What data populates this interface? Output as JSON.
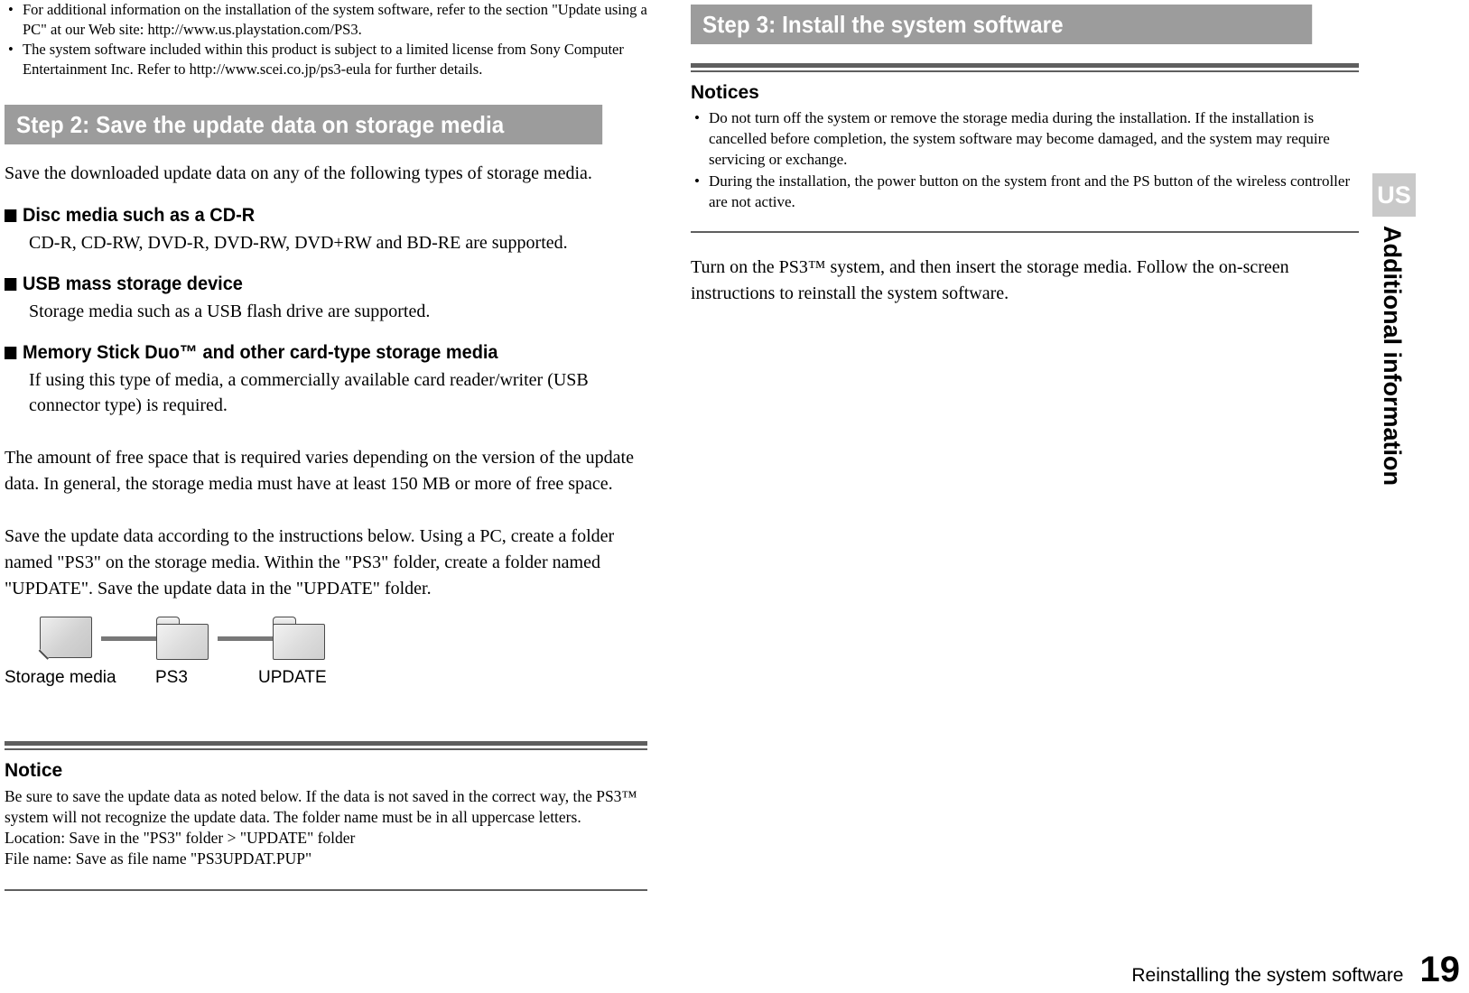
{
  "page": {
    "number": "19",
    "footer_section": "Reinstalling the system software",
    "region_tab": "US",
    "side_chapter": "Additional information"
  },
  "left_column": {
    "intro_bullets": [
      "For additional information on the installation of the system software, refer to the section \"Update using a PC\" at our Web site: http://www.us.playstation.com/PS3.",
      "The system software included within this product is subject to a limited license from Sony Computer Entertainment Inc. Refer to http://www.scei.co.jp/ps3-eula for further details."
    ],
    "step_bar": "Step 2:  Save the update data on storage media",
    "lead_paragraph": "Save the downloaded update data on any of the following types of storage media.",
    "media_types": [
      {
        "heading": "Disc media such as a CD-R",
        "description": "CD-R, CD-RW, DVD-R, DVD-RW, DVD+RW and BD-RE are supported."
      },
      {
        "heading": "USB mass storage device",
        "description": "Storage media such as a USB flash drive are supported."
      },
      {
        "heading": "Memory Stick Duo™ and other card-type storage media",
        "description": "If using this type of media, a commercially available card reader/writer (USB connector type) is required."
      }
    ],
    "free_space_paragraph": "The amount of free space that is required varies depending on the version of the update data. In general, the storage media must have at least 150 MB or more of free space.",
    "instructions_paragraph": "Save the update data according to the instructions below. Using a PC, create a folder named \"PS3\" on the storage media. Within the \"PS3\" folder, create a folder named \"UPDATE\". Save the update data in the \"UPDATE\" folder.",
    "diagram": {
      "items": [
        {
          "label": "Storage media",
          "icon": "memory-card-icon"
        },
        {
          "label": "PS3",
          "icon": "folder-icon"
        },
        {
          "label": "UPDATE",
          "icon": "folder-icon"
        }
      ]
    },
    "notice": {
      "heading": "Notice",
      "lines": [
        "Be sure to save the update data as noted below. If the data is not saved in the correct way, the PS3™ system will not recognize the update data. The folder name must be in all uppercase letters.",
        "Location: Save in the \"PS3\" folder > \"UPDATE\" folder",
        "File name: Save as file name \"PS3UPDAT.PUP\""
      ]
    }
  },
  "right_column": {
    "step_bar": "Step 3:  Install the system software",
    "notices": {
      "heading": "Notices",
      "items": [
        "Do not turn off the system or remove the storage media during the installation. If the installation is cancelled before completion, the system software may become damaged, and the system may require servicing or exchange.",
        "During the installation, the power button on the system front and the PS button of the wireless controller are not active."
      ]
    },
    "closing_paragraph": "Turn on the PS3™ system, and then insert the storage media. Follow the on-screen instructions to reinstall the system software."
  },
  "colors": {
    "step_bar_bg": "#9c9c9c",
    "rule": "#5f5f5f",
    "tab_bg": "#c9c9c9"
  }
}
